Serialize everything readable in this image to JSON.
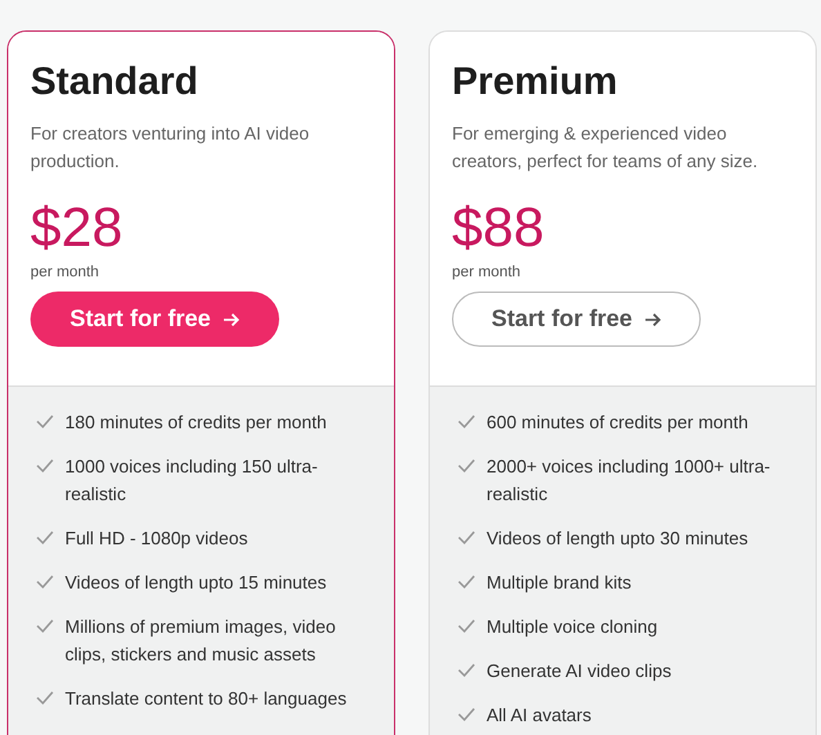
{
  "plans": [
    {
      "name": "Standard",
      "description": "For creators venturing into AI video production.",
      "price": "$28",
      "period": "per month",
      "button": "Start for free",
      "highlighted": true,
      "features": [
        "180 minutes of credits per month",
        "1000 voices including 150 ultra-realistic",
        "Full HD - 1080p videos",
        "Videos of length upto 15 minutes",
        "Millions of premium images, video clips, stickers and music assets",
        "Translate content to 80+ languages"
      ]
    },
    {
      "name": "Premium",
      "description": "For emerging & experienced video creators, perfect for teams of any size.",
      "price": "$88",
      "period": "per month",
      "button": "Start for free",
      "highlighted": false,
      "features": [
        "600 minutes of credits per month",
        "2000+ voices including 1000+ ultra-realistic",
        "Videos of length upto 30 minutes",
        "Multiple brand kits",
        "Multiple voice cloning",
        "Generate AI video clips",
        "All AI avatars"
      ]
    }
  ]
}
